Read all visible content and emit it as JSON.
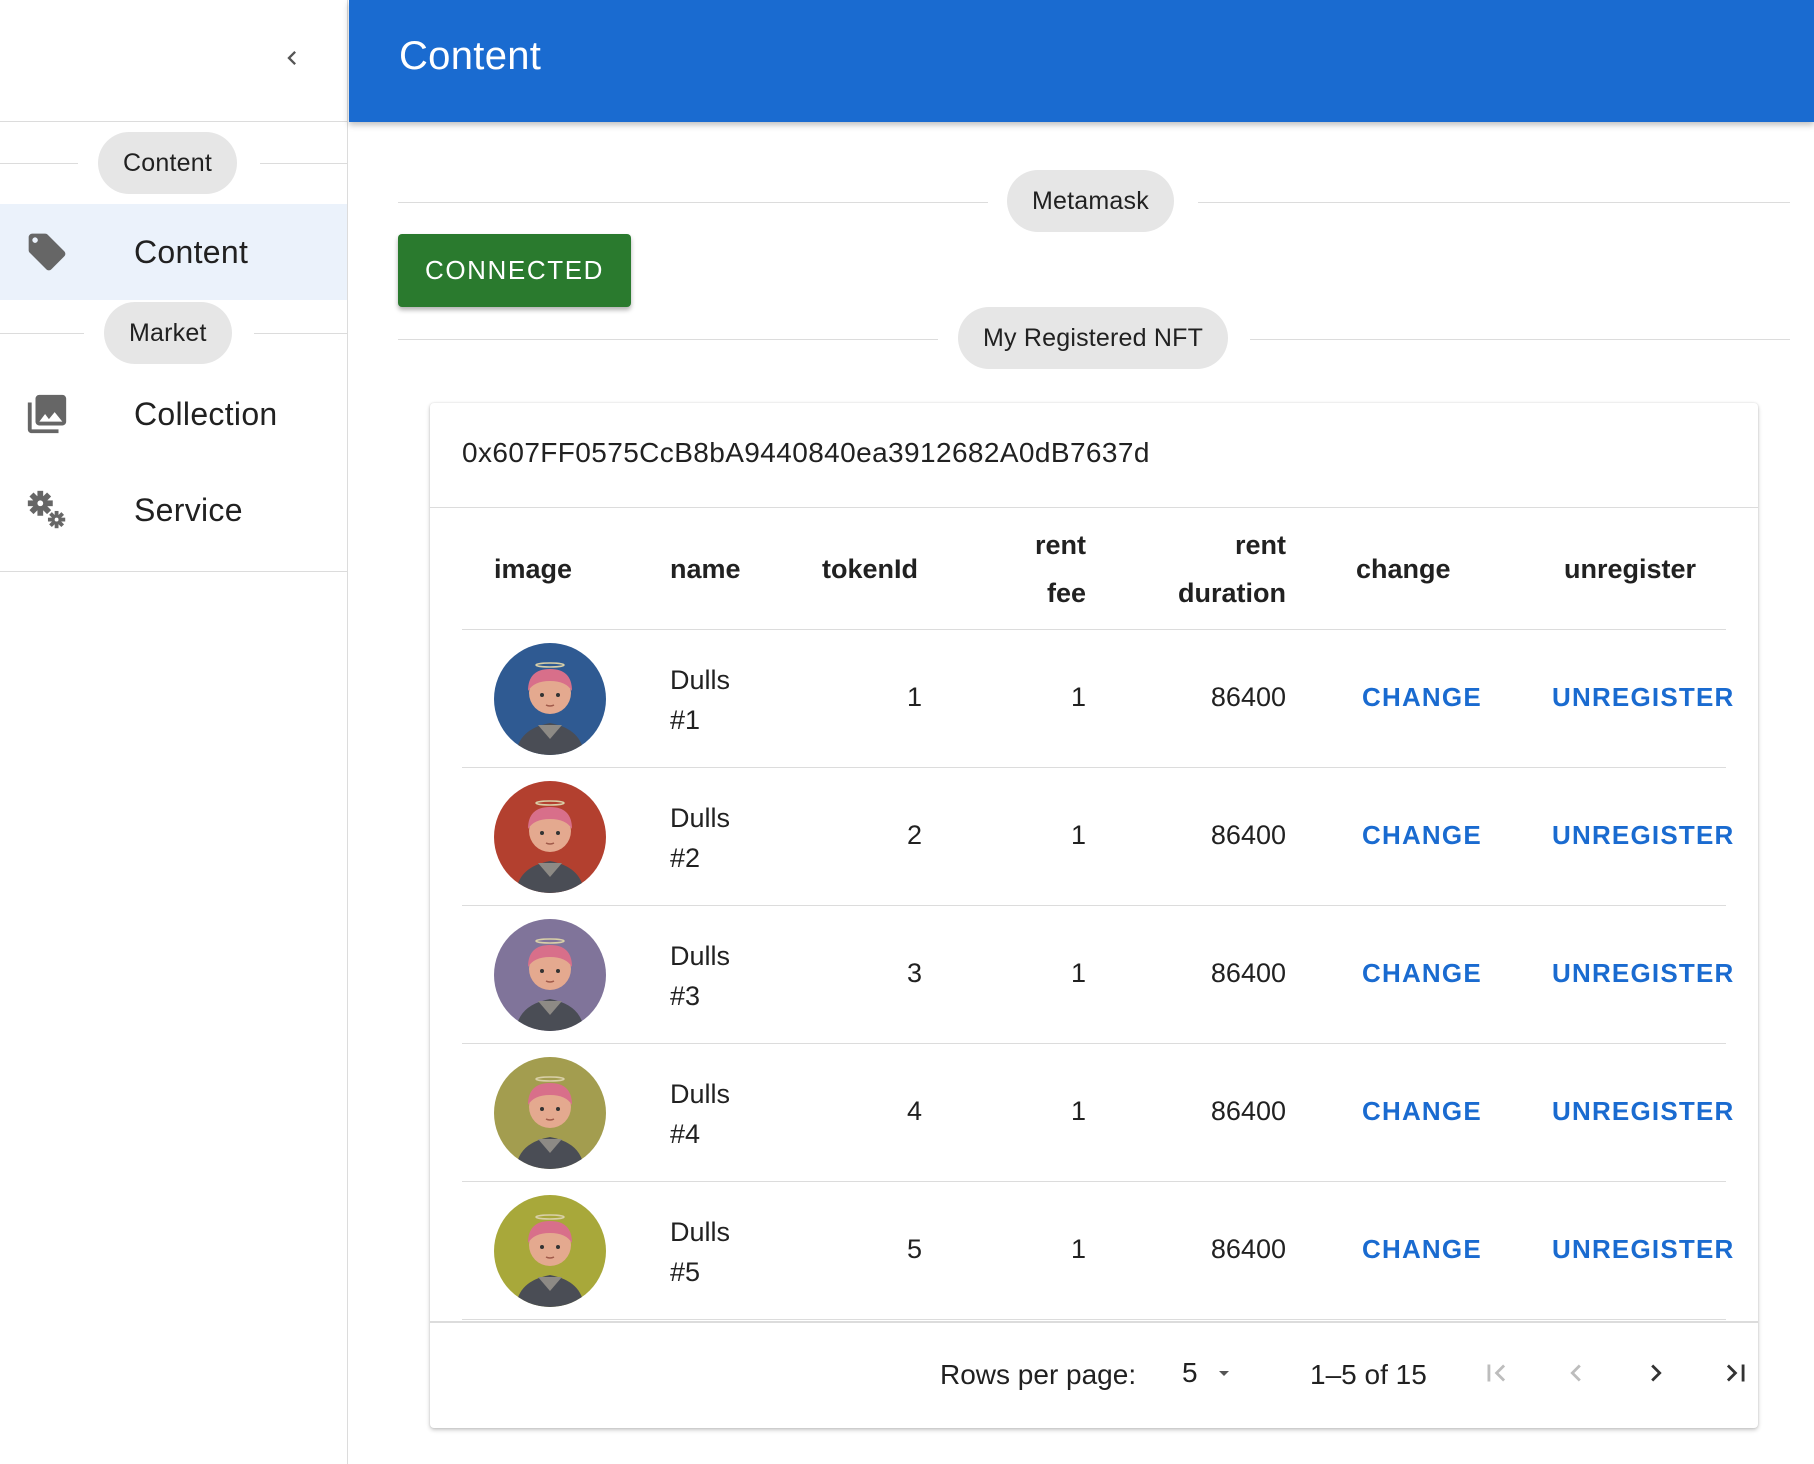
{
  "sidebar": {
    "sections": [
      {
        "label": "Content"
      },
      {
        "label": "Market"
      }
    ],
    "items": [
      {
        "label": "Content",
        "icon": "tag-icon",
        "active": true
      },
      {
        "label": "Collection",
        "icon": "photo-library-icon",
        "active": false
      },
      {
        "label": "Service",
        "icon": "gears-icon",
        "active": false
      }
    ]
  },
  "appbar": {
    "title": "Content"
  },
  "main": {
    "metamask_chip": "Metamask",
    "connected_label": "CONNECTED",
    "registered_chip": "My Registered NFT",
    "address": "0x607FF0575CcB8bA9440840ea3912682A0dB7637d",
    "table": {
      "headers": {
        "image": "image",
        "name": "name",
        "tokenId": "tokenId",
        "rent_fee_1": "rent",
        "rent_fee_2": "fee",
        "rent_duration_1": "rent",
        "rent_duration_2": "duration",
        "change": "change",
        "unregister": "unregister"
      },
      "rows": [
        {
          "name_1": "Dulls",
          "name_2": "#1",
          "tokenId": "1",
          "rent_fee": "1",
          "rent_duration": "86400",
          "change": "CHANGE",
          "unregister": "UNREGISTER",
          "bg": "#2f5a92"
        },
        {
          "name_1": "Dulls",
          "name_2": "#2",
          "tokenId": "2",
          "rent_fee": "1",
          "rent_duration": "86400",
          "change": "CHANGE",
          "unregister": "UNREGISTER",
          "bg": "#b3402f"
        },
        {
          "name_1": "Dulls",
          "name_2": "#3",
          "tokenId": "3",
          "rent_fee": "1",
          "rent_duration": "86400",
          "change": "CHANGE",
          "unregister": "UNREGISTER",
          "bg": "#80749a"
        },
        {
          "name_1": "Dulls",
          "name_2": "#4",
          "tokenId": "4",
          "rent_fee": "1",
          "rent_duration": "86400",
          "change": "CHANGE",
          "unregister": "UNREGISTER",
          "bg": "#a39d4f"
        },
        {
          "name_1": "Dulls",
          "name_2": "#5",
          "tokenId": "5",
          "rent_fee": "1",
          "rent_duration": "86400",
          "change": "CHANGE",
          "unregister": "UNREGISTER",
          "bg": "#a8a83a"
        }
      ]
    },
    "pagination": {
      "rows_per_page_label": "Rows per page:",
      "rows_per_page_value": "5",
      "range": "1–5 of 15"
    }
  },
  "colors": {
    "appbar": "#1a6bd0",
    "connected": "#2a7a2e",
    "link": "#1a6bd0",
    "active_nav": "#ebf2fb"
  }
}
